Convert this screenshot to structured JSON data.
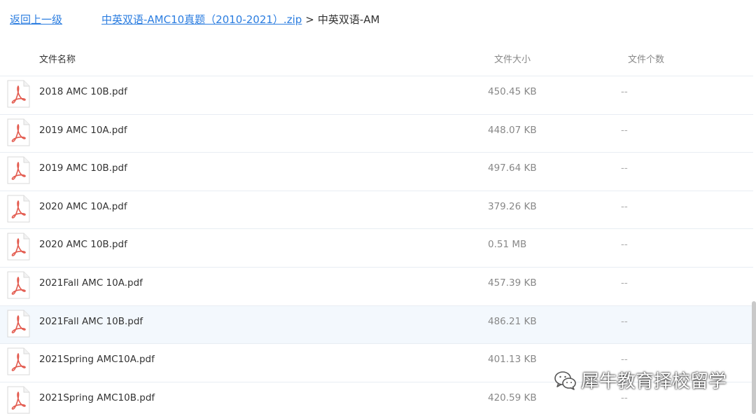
{
  "breadcrumb": {
    "back_label": "返回上一级",
    "zip_label": "中英双语-AMC10真题（2010-2021）.zip",
    "separator": ">",
    "current_label": "中英双语-AM"
  },
  "table": {
    "headers": {
      "name": "文件名称",
      "size": "文件大小",
      "count": "文件个数"
    },
    "rows": [
      {
        "name": "2018 AMC 10B.pdf",
        "size": "450.45 KB",
        "count": "--"
      },
      {
        "name": "2019 AMC 10A.pdf",
        "size": "448.07 KB",
        "count": "--"
      },
      {
        "name": "2019 AMC 10B.pdf",
        "size": "497.64 KB",
        "count": "--"
      },
      {
        "name": "2020 AMC 10A.pdf",
        "size": "379.26 KB",
        "count": "--"
      },
      {
        "name": "2020 AMC 10B.pdf",
        "size": "0.51 MB",
        "count": "--"
      },
      {
        "name": "2021Fall AMC 10A.pdf",
        "size": "457.39 KB",
        "count": "--"
      },
      {
        "name": "2021Fall AMC 10B.pdf",
        "size": "486.21 KB",
        "count": "--"
      },
      {
        "name": "2021Spring AMC10A.pdf",
        "size": "401.13 KB",
        "count": "--"
      },
      {
        "name": "2021Spring AMC10B.pdf",
        "size": "420.59 KB",
        "count": "--"
      }
    ]
  },
  "watermark": {
    "text": "犀牛教育择校留学"
  },
  "colors": {
    "link": "#2b7de0",
    "row_border": "#e8edf3",
    "hover_row": "#f3f8fd",
    "pdf_red": "#e35b4f"
  },
  "icons": {
    "file_icon": "pdf-icon",
    "watermark_icon": "wechat-icon"
  }
}
